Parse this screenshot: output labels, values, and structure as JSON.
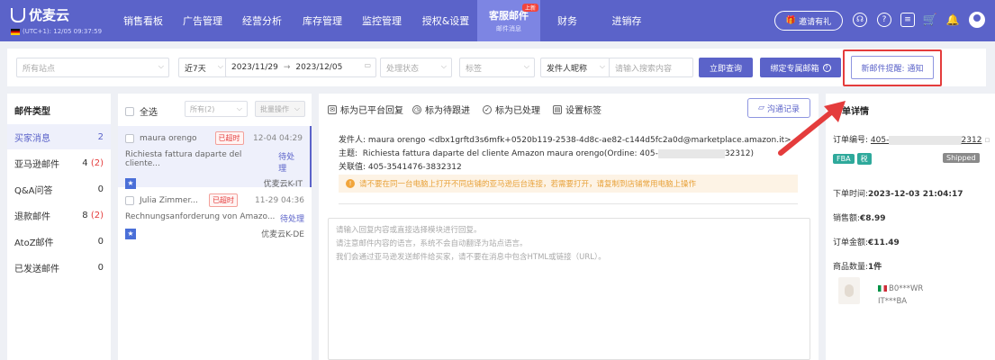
{
  "brand": {
    "name": "优麦云",
    "timezone": "(UTC+1): 12/05 09:37:59"
  },
  "nav": {
    "items": [
      {
        "label": "销售看板"
      },
      {
        "label": "广告管理"
      },
      {
        "label": "经营分析"
      },
      {
        "label": "库存管理"
      },
      {
        "label": "监控管理"
      },
      {
        "label": "授权&设置"
      },
      {
        "label": "客服邮件",
        "sub": "邮件消息",
        "badge": "上新"
      },
      {
        "label": "财务"
      },
      {
        "label": "进销存"
      }
    ],
    "invite": "邀请有礼",
    "icons": [
      "headset-icon",
      "help-icon",
      "message-icon",
      "cart-icon",
      "bell-icon",
      "user-icon"
    ]
  },
  "filters": {
    "store_placeholder": "所有站点",
    "range": "近7天",
    "date_start": "2023/11/29",
    "date_sep": "→",
    "date_end": "2023/12/05",
    "status_placeholder": "处理状态",
    "tag_placeholder": "标签",
    "sender_field": "发件人昵称",
    "search_placeholder": "请输入搜索内容",
    "search_button": "立即查询",
    "bind_button": "绑定专属邮箱",
    "notify_button": "新邮件提醒: 通知"
  },
  "mail_types": {
    "title": "邮件类型",
    "items": [
      {
        "label": "买家消息",
        "count": "2",
        "unread": ""
      },
      {
        "label": "亚马逊邮件",
        "count": "4",
        "unread": "(2)"
      },
      {
        "label": "Q&A问答",
        "count": "0",
        "unread": ""
      },
      {
        "label": "退款邮件",
        "count": "8",
        "unread": "(2)"
      },
      {
        "label": "AtoZ邮件",
        "count": "0",
        "unread": ""
      },
      {
        "label": "已发送邮件",
        "count": "0",
        "unread": ""
      }
    ]
  },
  "list": {
    "select_all": "全选",
    "filter_all": "所有(2)",
    "batch": "批量操作",
    "cards": [
      {
        "name": "maura orengo",
        "badge": "已超时",
        "time": "12-04 04:29",
        "subject": "Richiesta fattura daparte del cliente...",
        "status": "待处理",
        "store": "优麦云K-IT"
      },
      {
        "name": "Julia Zimmer...",
        "badge": "已超时",
        "time": "11-29 04:36",
        "subject": "Rechnungsanforderung von Amazo...",
        "status": "待处理",
        "store": "优麦云K-DE"
      }
    ]
  },
  "detail": {
    "actions": [
      "标为已平台回复",
      "标为待跟进",
      "标为已处理",
      "设置标签"
    ],
    "comm_button": "沟通记录",
    "sender_label": "发件人:",
    "sender_value": "maura orengo <dbx1grftd3s6mfk+0520b119-2538-4d8c-ae82-c144d5fc2a0d@marketplace.amazon.it>",
    "subject_label": "主题:",
    "subject_value_a": "Richiesta fattura daparte del cliente Amazon maura orengo(Ordine: 405-",
    "subject_value_b": "32312)",
    "key_label": "关联值:",
    "key_value": "405-3541476-3832312",
    "warning": "请不要在同一台电脑上打开不同店铺的亚马逊后台连接，若需要打开，请复制到店铺常用电脑上操作",
    "reply_lines": [
      "请输入回复内容或直接选择模块进行回复。",
      "请注意邮件内容的语言，系统不会自动翻译为站点语言。",
      "我们会通过亚马逊发送邮件给买家，请不要在消息中包含HTML或链接（URL）。"
    ]
  },
  "order": {
    "title": "单详情",
    "order_no_label": "订单编号:",
    "order_no_a": "405-",
    "order_no_b": "2312",
    "tag_fba": "FBA",
    "tag_tax": "税",
    "shipped": "Shipped",
    "order_time_label": "下单时间:",
    "order_time": "2023-12-03 21:04:17",
    "sales_label": "销售额:",
    "sales": "€8.99",
    "total_label": "订单金额:",
    "total": "€11.49",
    "qty_label": "商品数量:",
    "qty": "1件",
    "asin": "B0***WR",
    "sku": "IT***BA"
  },
  "colors": {
    "primary": "#5b63c9",
    "danger": "#e43c3c",
    "warning": "#f1a53b",
    "highlight": "#e43c3c"
  }
}
